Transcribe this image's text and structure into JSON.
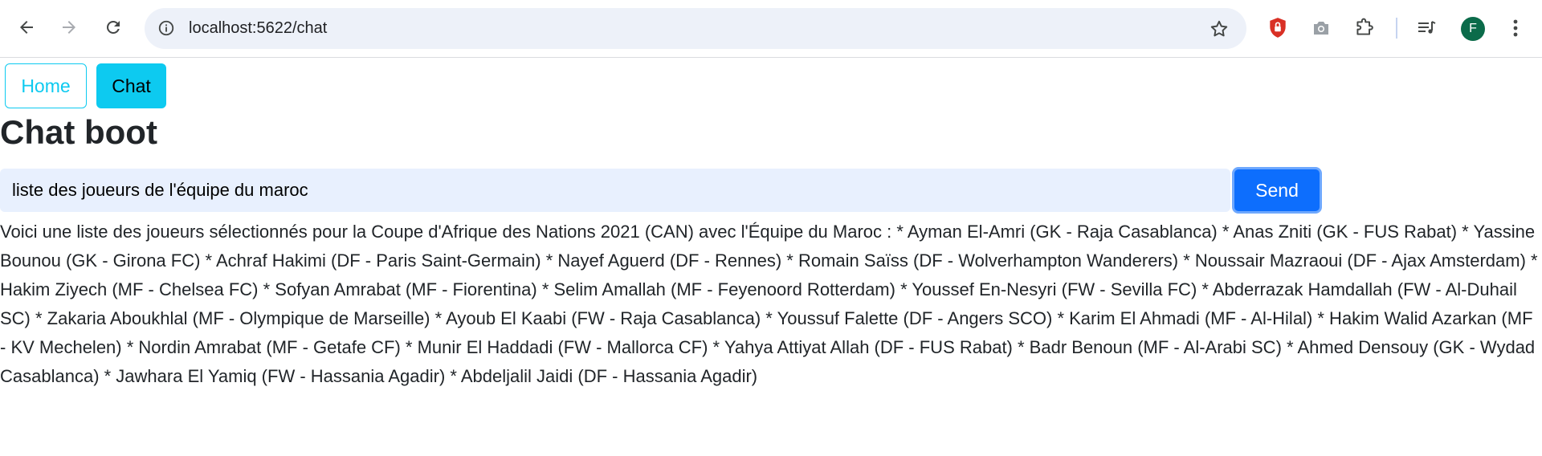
{
  "browser": {
    "url": "localhost:5622/chat",
    "profile_initial": "F",
    "icons": [
      "back-icon",
      "forward-icon",
      "reload-icon",
      "site-info-icon",
      "bookmark-star-icon",
      "shield-extension-icon",
      "camera-extension-icon",
      "extensions-puzzle-icon",
      "media-controls-icon",
      "kebab-menu-icon"
    ],
    "colors": {
      "omnibox_bg": "#edf1f9",
      "avatar_bg": "#0b6b4a",
      "shield_red": "#d93025"
    }
  },
  "nav": {
    "home_label": "Home",
    "chat_label": "Chat"
  },
  "page": {
    "title": "Chat boot"
  },
  "chat": {
    "input_value": "liste des joueurs de l'équipe du maroc",
    "send_label": "Send",
    "response": "Voici une liste des joueurs sélectionnés pour la Coupe d'Afrique des Nations 2021 (CAN) avec l'Équipe du Maroc : * Ayman El-Amri (GK - Raja Casablanca) * Anas Zniti (GK - FUS Rabat) * Yassine Bounou (GK - Girona FC) * Achraf Hakimi (DF - Paris Saint-Germain) * Nayef Aguerd (DF - Rennes) * Romain Saïss (DF - Wolverhampton Wanderers) * Noussair Mazraoui (DF - Ajax Amsterdam) * Hakim Ziyech (MF - Chelsea FC) * Sofyan Amrabat (MF - Fiorentina) * Selim Amallah (MF - Feyenoord Rotterdam) * Youssef En-Nesyri (FW - Sevilla FC) * Abderrazak Hamdallah (FW - Al-Duhail SC) * Zakaria Aboukhlal (MF - Olympique de Marseille) * Ayoub El Kaabi (FW - Raja Casablanca) * Youssuf Falette (DF - Angers SCO) * Karim El Ahmadi (MF - Al-Hilal) * Hakim Walid Azarkan (MF - KV Mechelen) * Nordin Amrabat (MF - Getafe CF) * Munir El Haddadi (FW - Mallorca CF) * Yahya Attiyat Allah (DF - FUS Rabat) * Badr Benoun (MF - Al-Arabi SC) * Ahmed Densouy (GK - Wydad Casablanca) * Jawhara El Yamiq (FW - Hassania Agadir) * Abdeljalil Jaidi (DF - Hassania Agadir)"
  },
  "colors": {
    "info": "#0dcaf0",
    "primary": "#0d6efd",
    "input_bg": "#e8f0fe",
    "text": "#212529"
  }
}
